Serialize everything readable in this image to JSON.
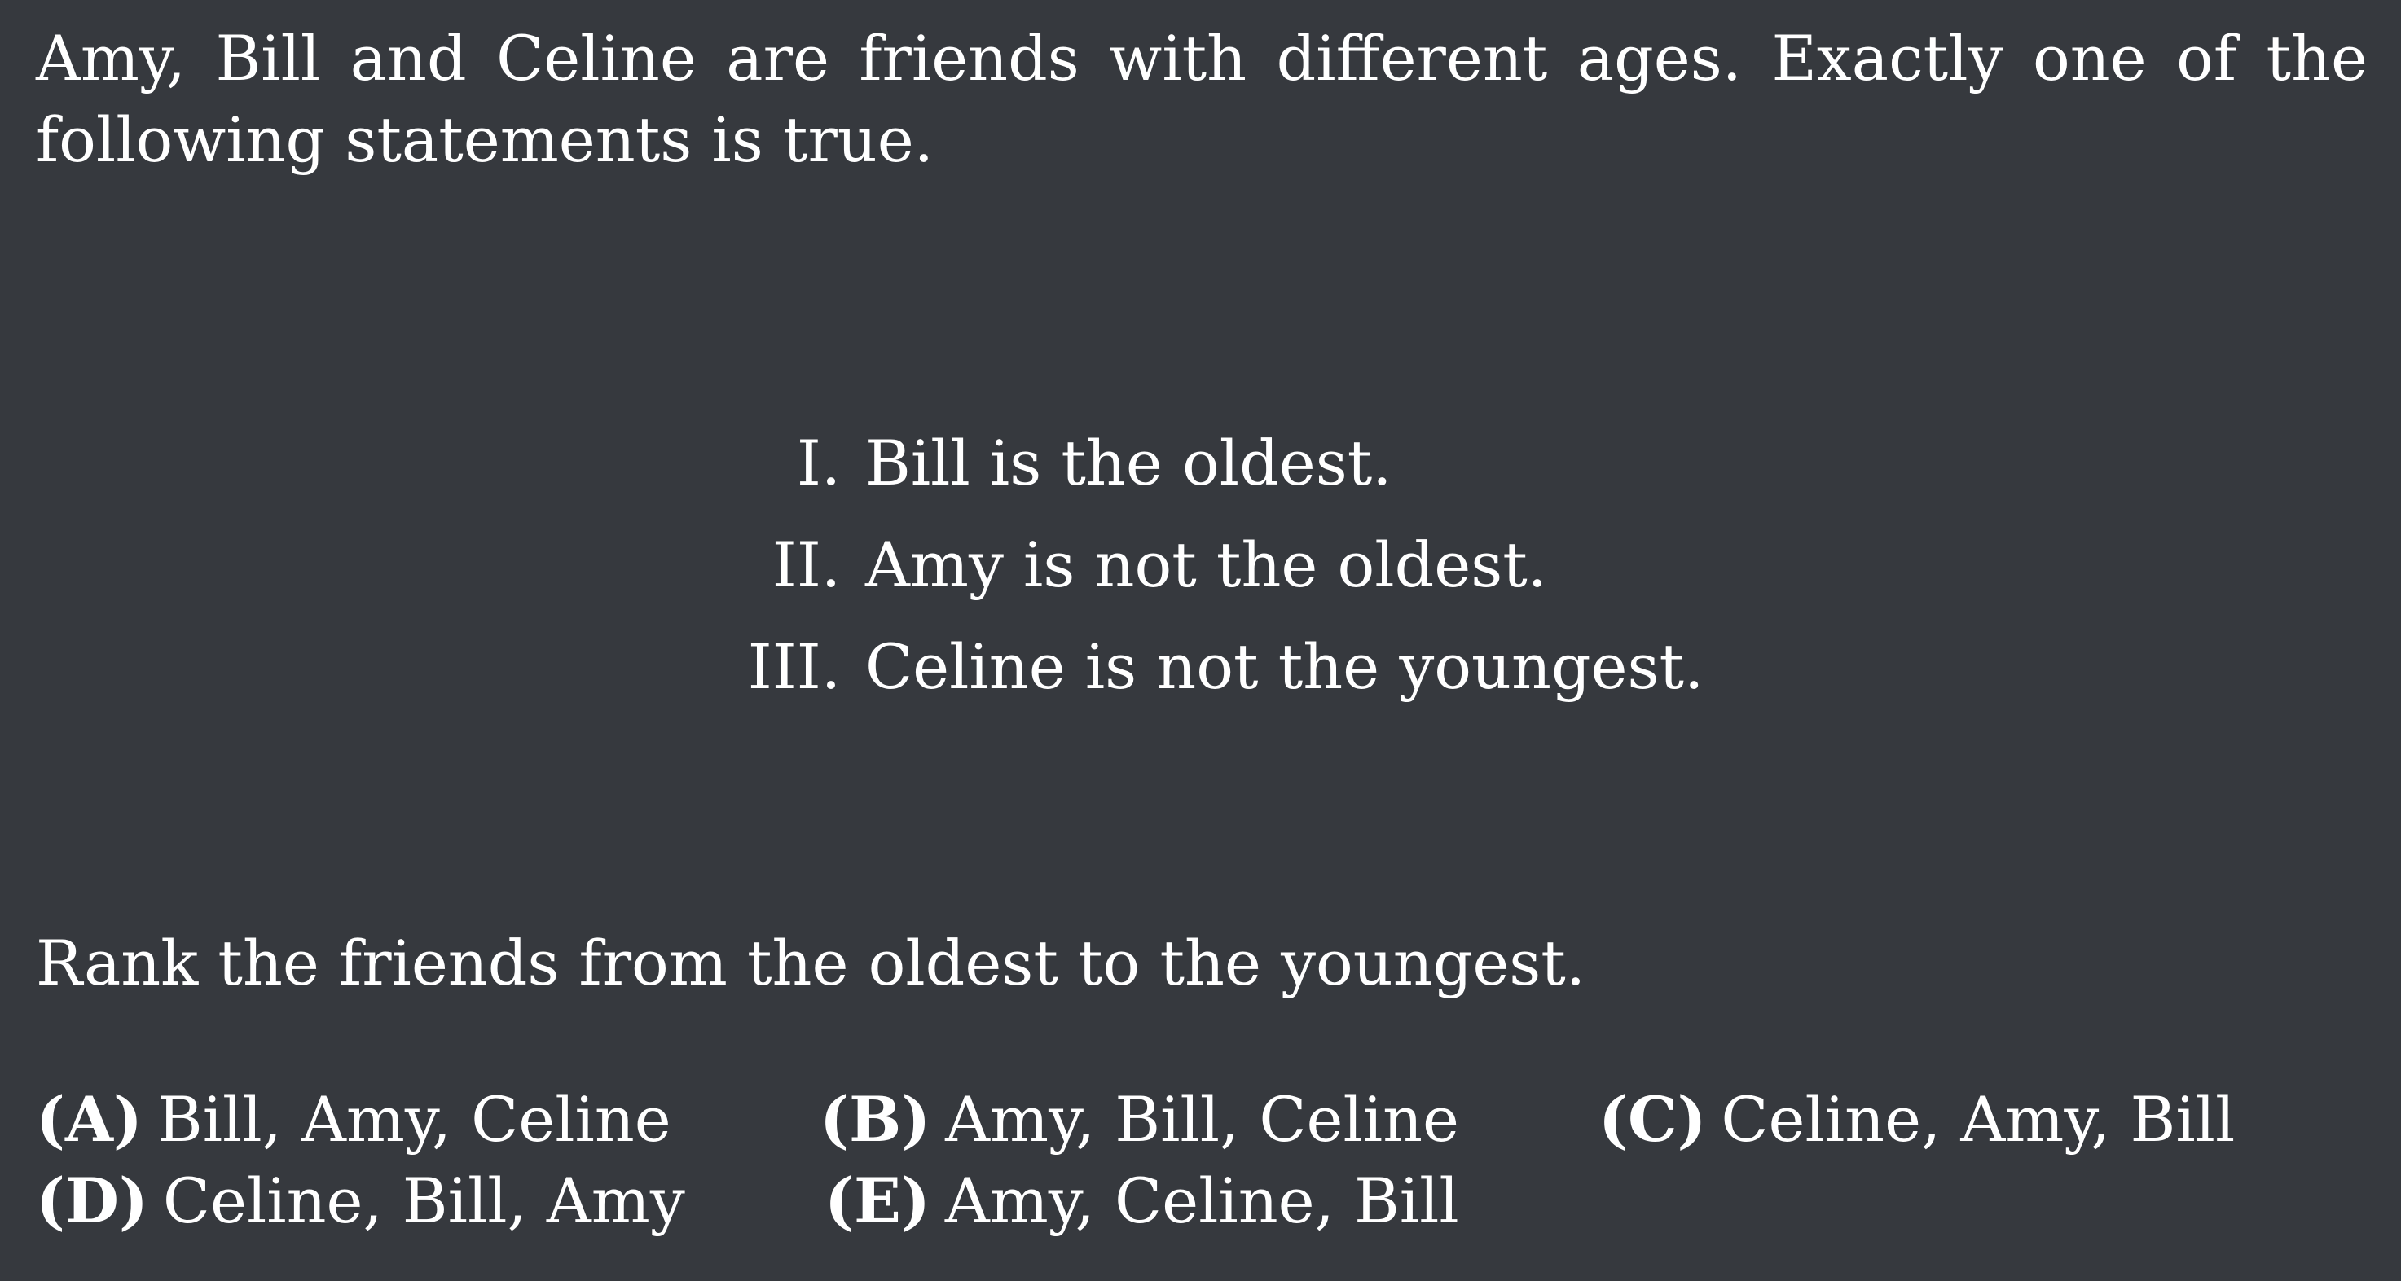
{
  "problem": {
    "intro": "Amy, Bill and Celine are friends with different ages.  Exactly one of the following statements is true.",
    "statements": [
      {
        "num": "I.",
        "text": "Bill is the oldest."
      },
      {
        "num": "II.",
        "text": "Amy is not the oldest."
      },
      {
        "num": "III.",
        "text": "Celine is not the youngest."
      }
    ],
    "question": "Rank the friends from the oldest to the youngest.",
    "choices": [
      {
        "letter": "(A)",
        "text": "Bill, Amy, Celine"
      },
      {
        "letter": "(B)",
        "text": "Amy, Bill, Celine"
      },
      {
        "letter": "(C)",
        "text": "Celine, Amy, Bill"
      },
      {
        "letter": "(D)",
        "text": "Celine, Bill, Amy"
      },
      {
        "letter": "(E)",
        "text": "Amy, Celine, Bill"
      }
    ]
  }
}
